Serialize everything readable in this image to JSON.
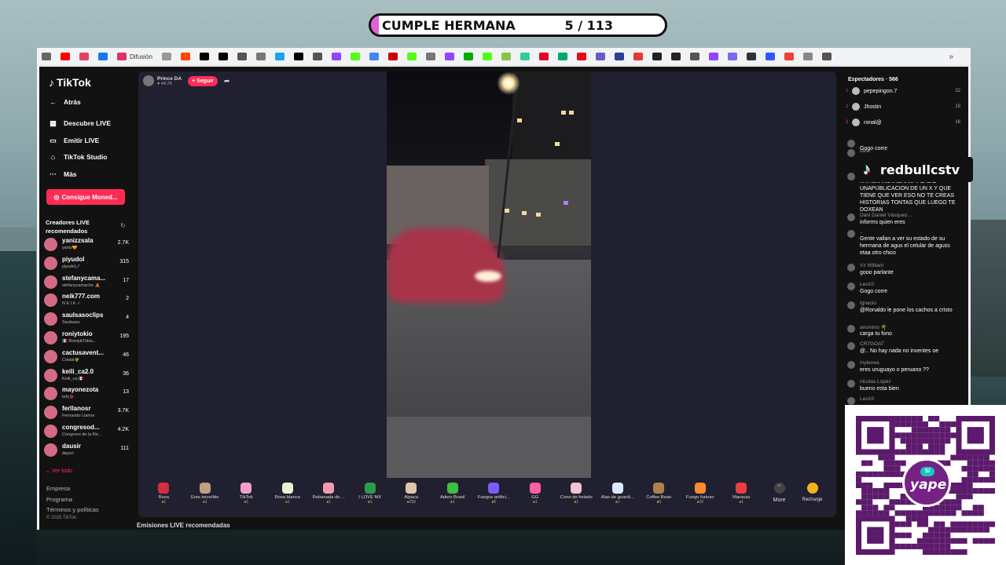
{
  "overlay": {
    "title": "CUMPLE HERMANA",
    "counter": "5 / 113",
    "brand": "redbullcstv"
  },
  "bookmarks": {
    "difusion_label": "Difusión",
    "colors": [
      "#666",
      "#ff0000",
      "#e4405f",
      "#1877f2",
      "#e1306c",
      "#999",
      "#ff4500",
      "#000",
      "#000",
      "#555",
      "#777",
      "#1da1f2",
      "#000",
      "#555",
      "#9146ff",
      "#53fc18",
      "#4285f4",
      "#c00",
      "#53fc18",
      "#777",
      "#9146ff",
      "#0a0",
      "#53fc18",
      "#8bc34a",
      "#3c9",
      "#e60023",
      "#0a6",
      "#e50914",
      "#6a5acd",
      "#2a3f8f",
      "#e53935",
      "#222",
      "#222",
      "#555",
      "#9146ff",
      "#7b68ee",
      "#333",
      "#3355ff",
      "#ea4335",
      "#888",
      "#555"
    ],
    "more": "»"
  },
  "sidebar": {
    "logo": "TikTok",
    "back": "Atrás",
    "nav": [
      {
        "label": "Descubre LIVE",
        "icon": "▦"
      },
      {
        "label": "Emitir LIVE",
        "icon": "▭"
      },
      {
        "label": "TikTok Studio",
        "icon": "⌂"
      },
      {
        "label": "Más",
        "icon": "···"
      }
    ],
    "coins_button": "Consigue Moned...",
    "creators_heading": "Creadores LIVE recomendados",
    "creators": [
      {
        "name": "yanizzsala",
        "sub": "yaniz🧡",
        "viewers": "2.7K"
      },
      {
        "name": "piyudol",
        "sub": "piyudol🖊️",
        "viewers": "315"
      },
      {
        "name": "stefanycama...",
        "sub": "stefanycamacho 🧸",
        "viewers": "17"
      },
      {
        "name": "neik777.com",
        "sub": "N E I K ✓",
        "viewers": "2"
      },
      {
        "name": "saulsasoclips",
        "sub": "Saulsaso",
        "viewers": "4"
      },
      {
        "name": "roniytokio",
        "sub": "🇲🇽 Roniy&Tokio...",
        "viewers": "195"
      },
      {
        "name": "cactusavent...",
        "sub": "Cristal🌵",
        "viewers": "46"
      },
      {
        "name": "keili_ca2.0",
        "sub": "Keili_ca 🇲🇽",
        "viewers": "36"
      },
      {
        "name": "mayonezota",
        "sub": "tefy🐞",
        "viewers": "13"
      },
      {
        "name": "ferllanosr",
        "sub": "Fernando Llanos",
        "viewers": "3.7K"
      },
      {
        "name": "congresod...",
        "sub": "Congreso de la Re...",
        "viewers": "4.2K"
      },
      {
        "name": "dausir",
        "sub": "daysri",
        "viewers": "111"
      }
    ],
    "see_all": "Ver todo",
    "footer": [
      "Empresa",
      "Programa",
      "Términos y políticas"
    ],
    "copyright": "© 2025 TikTok"
  },
  "live": {
    "host_name": "Prince DA",
    "host_likes": "44.7K",
    "follow_label": "+ Seguir",
    "gifts": [
      {
        "label": "Rosa",
        "price": "1",
        "color": "#d32f3f"
      },
      {
        "label": "Eres increíble",
        "price": "1",
        "color": "#c0a080"
      },
      {
        "label": "TikTok",
        "price": "1",
        "color": "#f3a0c8"
      },
      {
        "label": "Rosa blanca",
        "price": "1",
        "color": "#e9f3d0"
      },
      {
        "label": "Rebanada de ...",
        "price": "1",
        "color": "#f29bb0"
      },
      {
        "label": "I LOVE MX",
        "price": "1",
        "color": "#2e9b4b"
      },
      {
        "label": "Alpaca",
        "price": "299",
        "color": "#e0c6a8"
      },
      {
        "label": "Adoro Brasil",
        "price": "1",
        "color": "#3fbf3f"
      },
      {
        "label": "Fuegos artifici...",
        "price": "5",
        "color": "#7c5cff"
      },
      {
        "label": "GG",
        "price": "1",
        "color": "#ff5fa8"
      },
      {
        "label": "Cono de helado",
        "price": "1",
        "color": "#f6c0d8"
      },
      {
        "label": "Alas de guardi...",
        "price": "1",
        "color": "#dce8ff"
      },
      {
        "label": "Coffee Bean",
        "price": "5",
        "color": "#b08050"
      },
      {
        "label": "Fuego furioso",
        "price": "10",
        "color": "#ff8a30"
      },
      {
        "label": "Maracas",
        "price": "1",
        "color": "#e84040"
      }
    ],
    "more_label": "More",
    "recharge_label": "Recharge",
    "recommended_label": "Emisiones LIVE recomendadas"
  },
  "chat": {
    "viewers_heading": "Espectadores · 566",
    "top_viewers": [
      {
        "rank": "1",
        "name": "pepepingon.7",
        "count": "22"
      },
      {
        "rank": "2",
        "name": "Jhostin",
        "count": "19"
      },
      {
        "rank": "3",
        "name": "ronal@",
        "count": "16"
      }
    ],
    "messages": [
      {
        "user": "",
        "text": "Gogo corre"
      },
      {
        "user": "uwu",
        "text": ""
      },
      {
        "user": "",
        "text": "...TA EN INSTAGRAM Y SALIO UNAPUBLICACION DE UN X Y QUE TIENE QUE VER ESO NO TE CREAS HISTORIAS TONTAS QUE LUEGO TE DOXEAN"
      },
      {
        "user": "Dani Daniel Vásquez...",
        "text": "informs quien eres"
      },
      {
        "user": "..",
        "text": "Gente vallan a ver su estado de su hermana de agus el celular de aguss etaa otro chico"
      },
      {
        "user": "Vz William",
        "text": "gooo parlante"
      },
      {
        "user": "Leo10",
        "text": "Gogo corre"
      },
      {
        "user": "Ignacio",
        "text": "@Ronaldo le pone los cachos a cristo"
      },
      {
        "user": "anonimo 🌴",
        "text": "carga tu fono"
      },
      {
        "user": "CR7GOAT",
        "text": "@.. No hay nada no inventes oe"
      },
      {
        "user": "mylenea",
        "text": "eres uruguayo o peruano ??"
      },
      {
        "user": "nicolas Lopez",
        "text": "bueno esta bien"
      },
      {
        "user": "Leo10",
        "text": ""
      }
    ]
  },
  "qr": {
    "yape_badge": "S/",
    "yape_text": "yape"
  }
}
